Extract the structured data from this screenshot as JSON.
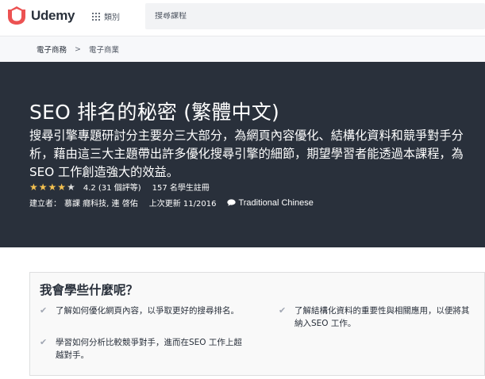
{
  "header": {
    "logo_text": "Udemy",
    "categories_label": "類別",
    "search_placeholder": "搜尋課程"
  },
  "breadcrumb": {
    "items": [
      "電子商務",
      "電子商業"
    ],
    "separator": ">"
  },
  "course": {
    "title": "SEO 排名的秘密 (繁體中文)",
    "subtitle": "搜尋引擎專題研討分主要分三大部分，為網頁內容優化、結構化資料和競爭對手分析，藉由這三大主題帶出許多優化搜尋引擎的細節，期望學習者能透過本課程，為SEO 工作創造強大的效益。",
    "rating": 4.2,
    "rating_text": "4.2 (31 個評等)",
    "students_text": "157 名學生註冊",
    "authors_label": "建立者：",
    "authors": "慕課 癮科技, 連 啓佑",
    "last_updated": "上次更新 11/2016",
    "language": "Traditional Chinese"
  },
  "learn": {
    "title": "我會學些什麼呢？",
    "items": [
      "了解如何優化網頁內容，以爭取更好的搜尋排名。",
      "學習如何分析比較競爭對手，進而在SEO 工作上超越對手。",
      "了解結構化資料的重要性與相關應用，以便將其納入SEO 工作。"
    ]
  },
  "colors": {
    "brand": "#ec5252",
    "hero_bg": "#29303b",
    "star": "#f4c150"
  }
}
